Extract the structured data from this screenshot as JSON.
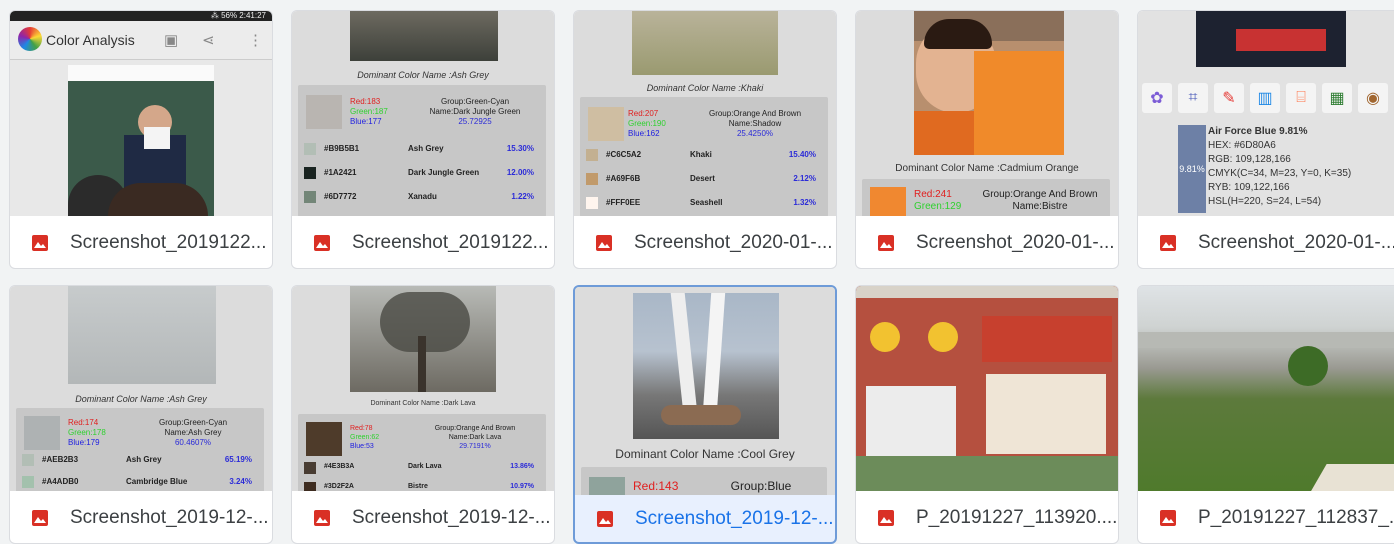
{
  "app": {
    "title": "Color Analysis",
    "status": "⁂ 56% 2:41:27"
  },
  "files": [
    {
      "name": "Screenshot_2019122...",
      "selected": false
    },
    {
      "name": "Screenshot_2019122...",
      "selected": false
    },
    {
      "name": "Screenshot_2020-01-...",
      "selected": false
    },
    {
      "name": "Screenshot_2020-01-...",
      "selected": false
    },
    {
      "name": "Screenshot_2020-01-...",
      "selected": false
    },
    {
      "name": "Screenshot_2019-12-...",
      "selected": false
    },
    {
      "name": "Screenshot_2019-12-...",
      "selected": false
    },
    {
      "name": "Screenshot_2019-12-...",
      "selected": true
    },
    {
      "name": "P_20191227_113920....",
      "selected": false
    },
    {
      "name": "P_20191227_112837_...",
      "selected": false
    }
  ],
  "thumb2": {
    "dominant": "Dominant Color Name :Ash Grey",
    "red": "Red:183",
    "green": "Green:187",
    "blue": "Blue:177",
    "group": "Group:Green-Cyan",
    "name": "Name:Dark Jungle Green",
    "pct": "25.72925",
    "rows": [
      {
        "hex": "#B9B5B1",
        "name": "Ash Grey",
        "pct": "15.30%",
        "color": "#b2beb5"
      },
      {
        "hex": "#1A2421",
        "name": "Dark Jungle Green",
        "pct": "12.00%",
        "color": "#1a2421"
      },
      {
        "hex": "#6D7772",
        "name": "Xanadu",
        "pct": "1.22%",
        "color": "#738678"
      }
    ]
  },
  "thumb3": {
    "dominant": "Dominant Color Name :Khaki",
    "red": "Red:207",
    "green": "Green:190",
    "blue": "Blue:162",
    "group": "Group:Orange And Brown",
    "name": "Name:Shadow",
    "pct": "25.4250%",
    "rows": [
      {
        "hex": "#C6C5A2",
        "name": "Khaki",
        "pct": "15.40%",
        "color": "#c3b091"
      },
      {
        "hex": "#A69F6B",
        "name": "Desert",
        "pct": "2.12%",
        "color": "#c19a6b"
      },
      {
        "hex": "#FFF0EE",
        "name": "Seashell",
        "pct": "1.32%",
        "color": "#fff5ee"
      }
    ]
  },
  "thumb4": {
    "dominant": "Dominant Color Name :Cadmium Orange",
    "red": "Red:241",
    "green": "Green:129",
    "group": "Group:Orange And Brown",
    "name": "Name:Bistre"
  },
  "thumb5": {
    "title": "Air Force Blue 9.81%",
    "hex": "HEX: #6D80A6",
    "rgb": "RGB: 109,128,166",
    "cmyk": "CMYK(C=34, M=23, Y=0, K=35)",
    "ryb": "RYB: 109,122,166",
    "hsl": "HSL(H=220, S=24, L=54)",
    "pct": "9.81%"
  },
  "thumb6": {
    "dominant": "Dominant Color Name :Ash Grey",
    "red": "Red:174",
    "green": "Green:178",
    "blue": "Blue:179",
    "group": "Group:Green-Cyan",
    "name": "Name:Ash Grey",
    "pct": "60.4607%",
    "rows": [
      {
        "hex": "#AEB2B3",
        "name": "Ash Grey",
        "pct": "65.19%",
        "color": "#b2beb5"
      },
      {
        "hex": "#A4ADB0",
        "name": "Cambridge Blue",
        "pct": "3.24%",
        "color": "#a3c1ad"
      }
    ]
  },
  "thumb7": {
    "dominant": "Dominant Color Name :Dark Lava",
    "red": "Red:78",
    "green": "Green:62",
    "blue": "Blue:53",
    "group": "Group:Orange And Brown",
    "name": "Name:Dark Lava",
    "pct": "29.7191%",
    "rows": [
      {
        "hex": "#4E3B3A",
        "name": "Dark Lava",
        "pct": "13.86%",
        "color": "#483c32"
      },
      {
        "hex": "#3D2F2A",
        "name": "Bistre",
        "pct": "10.97%",
        "color": "#3d2b1f"
      }
    ]
  },
  "thumb8": {
    "dominant": "Dominant Color Name :Cool Grey",
    "red": "Red:143",
    "group": "Group:Blue"
  },
  "colors": {
    "accent": "#1a73e8",
    "selected_border": "#6e9bd8",
    "image_icon": "#d93025"
  }
}
